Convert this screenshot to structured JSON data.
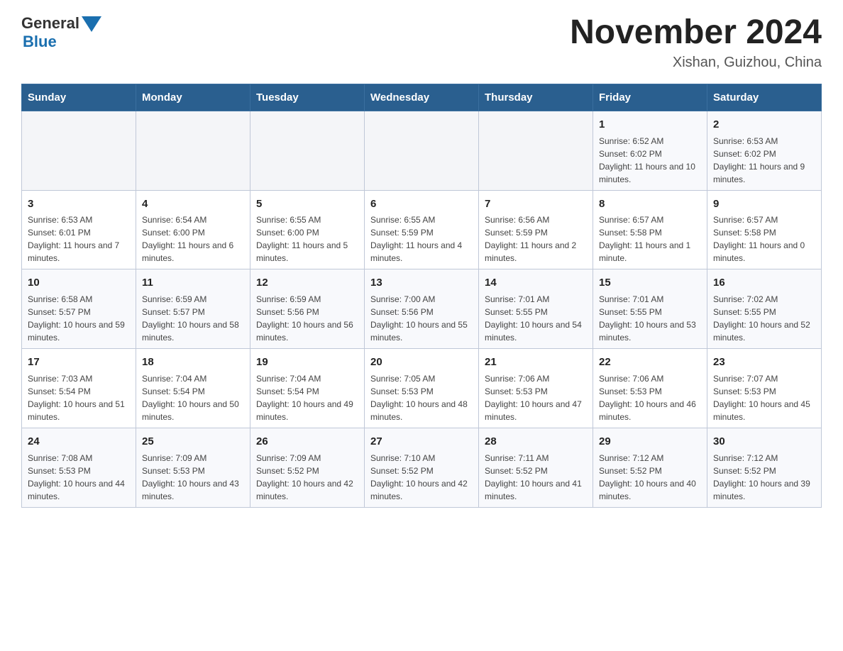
{
  "header": {
    "logo": {
      "general": "General",
      "blue": "Blue",
      "triangle_color": "#1a6faf"
    },
    "title": "November 2024",
    "subtitle": "Xishan, Guizhou, China"
  },
  "calendar": {
    "days_of_week": [
      "Sunday",
      "Monday",
      "Tuesday",
      "Wednesday",
      "Thursday",
      "Friday",
      "Saturday"
    ],
    "weeks": [
      [
        {
          "day": "",
          "info": ""
        },
        {
          "day": "",
          "info": ""
        },
        {
          "day": "",
          "info": ""
        },
        {
          "day": "",
          "info": ""
        },
        {
          "day": "",
          "info": ""
        },
        {
          "day": "1",
          "info": "Sunrise: 6:52 AM\nSunset: 6:02 PM\nDaylight: 11 hours and 10 minutes."
        },
        {
          "day": "2",
          "info": "Sunrise: 6:53 AM\nSunset: 6:02 PM\nDaylight: 11 hours and 9 minutes."
        }
      ],
      [
        {
          "day": "3",
          "info": "Sunrise: 6:53 AM\nSunset: 6:01 PM\nDaylight: 11 hours and 7 minutes."
        },
        {
          "day": "4",
          "info": "Sunrise: 6:54 AM\nSunset: 6:00 PM\nDaylight: 11 hours and 6 minutes."
        },
        {
          "day": "5",
          "info": "Sunrise: 6:55 AM\nSunset: 6:00 PM\nDaylight: 11 hours and 5 minutes."
        },
        {
          "day": "6",
          "info": "Sunrise: 6:55 AM\nSunset: 5:59 PM\nDaylight: 11 hours and 4 minutes."
        },
        {
          "day": "7",
          "info": "Sunrise: 6:56 AM\nSunset: 5:59 PM\nDaylight: 11 hours and 2 minutes."
        },
        {
          "day": "8",
          "info": "Sunrise: 6:57 AM\nSunset: 5:58 PM\nDaylight: 11 hours and 1 minute."
        },
        {
          "day": "9",
          "info": "Sunrise: 6:57 AM\nSunset: 5:58 PM\nDaylight: 11 hours and 0 minutes."
        }
      ],
      [
        {
          "day": "10",
          "info": "Sunrise: 6:58 AM\nSunset: 5:57 PM\nDaylight: 10 hours and 59 minutes."
        },
        {
          "day": "11",
          "info": "Sunrise: 6:59 AM\nSunset: 5:57 PM\nDaylight: 10 hours and 58 minutes."
        },
        {
          "day": "12",
          "info": "Sunrise: 6:59 AM\nSunset: 5:56 PM\nDaylight: 10 hours and 56 minutes."
        },
        {
          "day": "13",
          "info": "Sunrise: 7:00 AM\nSunset: 5:56 PM\nDaylight: 10 hours and 55 minutes."
        },
        {
          "day": "14",
          "info": "Sunrise: 7:01 AM\nSunset: 5:55 PM\nDaylight: 10 hours and 54 minutes."
        },
        {
          "day": "15",
          "info": "Sunrise: 7:01 AM\nSunset: 5:55 PM\nDaylight: 10 hours and 53 minutes."
        },
        {
          "day": "16",
          "info": "Sunrise: 7:02 AM\nSunset: 5:55 PM\nDaylight: 10 hours and 52 minutes."
        }
      ],
      [
        {
          "day": "17",
          "info": "Sunrise: 7:03 AM\nSunset: 5:54 PM\nDaylight: 10 hours and 51 minutes."
        },
        {
          "day": "18",
          "info": "Sunrise: 7:04 AM\nSunset: 5:54 PM\nDaylight: 10 hours and 50 minutes."
        },
        {
          "day": "19",
          "info": "Sunrise: 7:04 AM\nSunset: 5:54 PM\nDaylight: 10 hours and 49 minutes."
        },
        {
          "day": "20",
          "info": "Sunrise: 7:05 AM\nSunset: 5:53 PM\nDaylight: 10 hours and 48 minutes."
        },
        {
          "day": "21",
          "info": "Sunrise: 7:06 AM\nSunset: 5:53 PM\nDaylight: 10 hours and 47 minutes."
        },
        {
          "day": "22",
          "info": "Sunrise: 7:06 AM\nSunset: 5:53 PM\nDaylight: 10 hours and 46 minutes."
        },
        {
          "day": "23",
          "info": "Sunrise: 7:07 AM\nSunset: 5:53 PM\nDaylight: 10 hours and 45 minutes."
        }
      ],
      [
        {
          "day": "24",
          "info": "Sunrise: 7:08 AM\nSunset: 5:53 PM\nDaylight: 10 hours and 44 minutes."
        },
        {
          "day": "25",
          "info": "Sunrise: 7:09 AM\nSunset: 5:53 PM\nDaylight: 10 hours and 43 minutes."
        },
        {
          "day": "26",
          "info": "Sunrise: 7:09 AM\nSunset: 5:52 PM\nDaylight: 10 hours and 42 minutes."
        },
        {
          "day": "27",
          "info": "Sunrise: 7:10 AM\nSunset: 5:52 PM\nDaylight: 10 hours and 42 minutes."
        },
        {
          "day": "28",
          "info": "Sunrise: 7:11 AM\nSunset: 5:52 PM\nDaylight: 10 hours and 41 minutes."
        },
        {
          "day": "29",
          "info": "Sunrise: 7:12 AM\nSunset: 5:52 PM\nDaylight: 10 hours and 40 minutes."
        },
        {
          "day": "30",
          "info": "Sunrise: 7:12 AM\nSunset: 5:52 PM\nDaylight: 10 hours and 39 minutes."
        }
      ]
    ]
  }
}
